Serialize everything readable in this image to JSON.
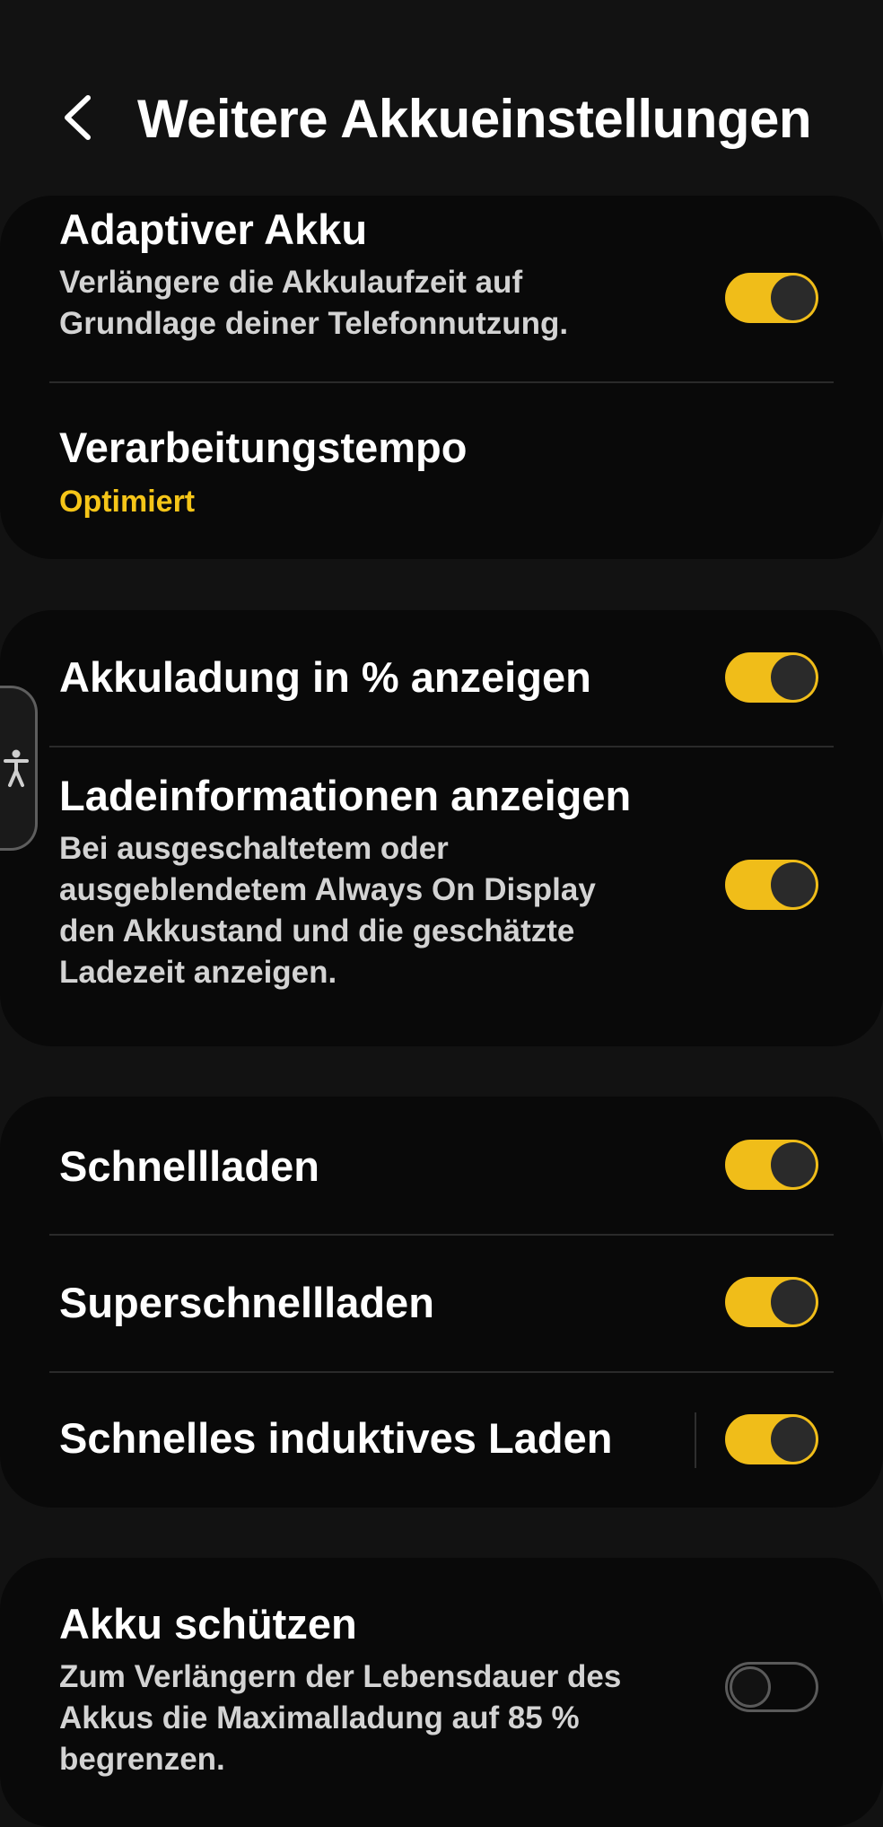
{
  "header": {
    "title": "Weitere Akkueinstellungen",
    "back_icon": "chevron-left-icon"
  },
  "accessibility": {
    "icon": "accessibility-person-icon"
  },
  "cards": [
    {
      "rows": [
        {
          "title": "Adaptiver Akku",
          "description": "Verlängere die Akkulaufzeit auf Grundlage deiner Telefonnutzung.",
          "toggle": true
        },
        {
          "title": "Verarbeitungstempo",
          "value": "Optimiert"
        }
      ]
    },
    {
      "rows": [
        {
          "title": "Akkuladung in % anzeigen",
          "toggle": true
        },
        {
          "title": "Ladeinformationen anzeigen",
          "description": "Bei ausgeschaltetem oder ausgeblendetem Always On Display den Akkustand und die geschätzte Ladezeit anzeigen.",
          "toggle": true
        }
      ]
    },
    {
      "rows": [
        {
          "title": "Schnellladen",
          "toggle": true
        },
        {
          "title": "Superschnellladen",
          "toggle": true
        },
        {
          "title": "Schnelles induktives Laden",
          "toggle": true
        }
      ]
    },
    {
      "rows": [
        {
          "title": "Akku schützen",
          "description": "Zum Verlängern der Lebensdauer des Akkus die Maximalladung auf 85 % begrenzen.",
          "toggle": false
        }
      ]
    }
  ],
  "colors": {
    "accent": "#f0bd19",
    "value_text": "#f5c518",
    "background": "#121212",
    "card": "#090909"
  }
}
